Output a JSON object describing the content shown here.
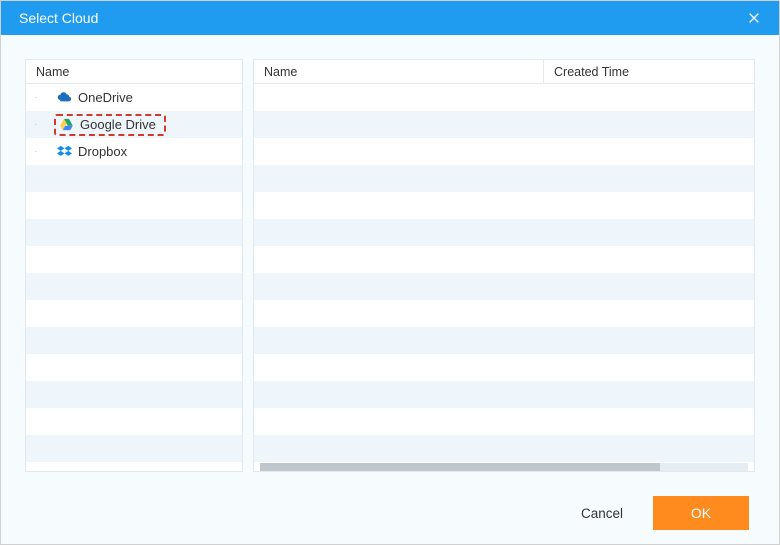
{
  "dialog": {
    "title": "Select Cloud"
  },
  "left_pane": {
    "header": "Name",
    "items": [
      {
        "label": "OneDrive",
        "icon": "onedrive-icon",
        "selected": false
      },
      {
        "label": "Google Drive",
        "icon": "google-drive-icon",
        "selected": true
      },
      {
        "label": "Dropbox",
        "icon": "dropbox-icon",
        "selected": false
      }
    ]
  },
  "right_pane": {
    "columns": [
      {
        "label": "Name"
      },
      {
        "label": "Created Time"
      }
    ],
    "rows": []
  },
  "footer": {
    "cancel_label": "Cancel",
    "ok_label": "OK"
  }
}
